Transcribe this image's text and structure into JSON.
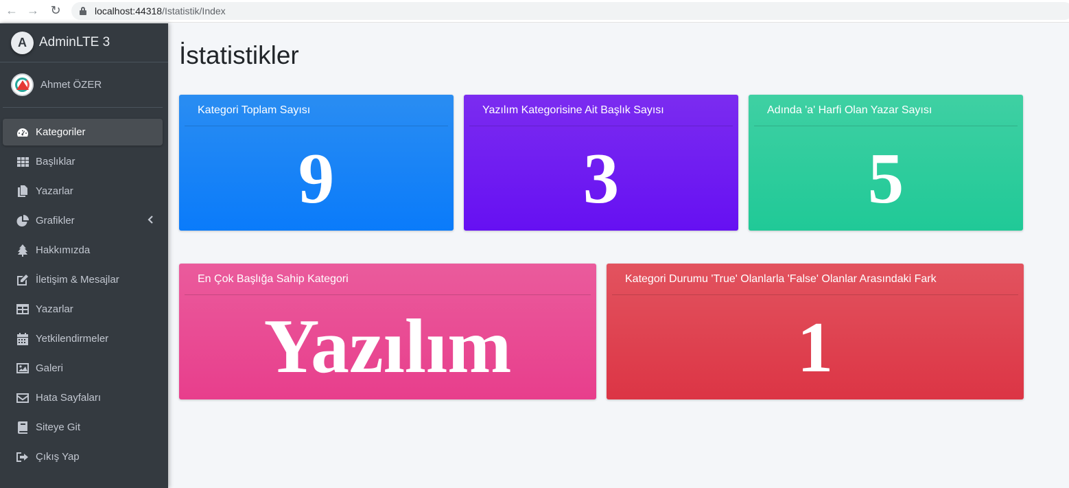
{
  "browser": {
    "url_host": "localhost:44318",
    "url_path": "/Istatistik/Index"
  },
  "sidebar": {
    "brand": "AdminLTE 3",
    "brand_logo_letter": "A",
    "user_name": "Ahmet ÖZER",
    "items": [
      {
        "label": "Kategoriler",
        "icon": "tachometer-icon",
        "active": true
      },
      {
        "label": "Başlıklar",
        "icon": "grid-icon"
      },
      {
        "label": "Yazarlar",
        "icon": "copy-icon"
      },
      {
        "label": "Grafikler",
        "icon": "pie-chart-icon"
      },
      {
        "label": "Hakkımızda",
        "icon": "tree-icon"
      },
      {
        "label": "İletişim & Mesajlar",
        "icon": "edit-icon"
      },
      {
        "label": "Yazarlar",
        "icon": "table-icon"
      },
      {
        "label": "Yetkilendirmeler",
        "icon": "calendar-icon"
      },
      {
        "label": "Galeri",
        "icon": "image-icon"
      },
      {
        "label": "Hata Sayfaları",
        "icon": "envelope-icon"
      },
      {
        "label": "Siteye Git",
        "icon": "book-icon"
      },
      {
        "label": "Çıkış Yap",
        "icon": "sign-out-icon"
      }
    ]
  },
  "main": {
    "title": "İstatistikler",
    "cards": [
      {
        "title": "Kategori Toplam Sayısı",
        "value": "9",
        "color": "#007bff"
      },
      {
        "title": "Yazılım Kategorisine Ait Başlık Sayısı",
        "value": "3",
        "color": "#6610f2"
      },
      {
        "title": "Adında 'a' Harfi Olan Yazar Sayısı",
        "value": "5",
        "color": "#20c997"
      },
      {
        "title": "En Çok Başlığa Sahip Kategori",
        "value": "Yazılım",
        "color": "#e83e8c"
      },
      {
        "title": "Kategori Durumu 'True' Olanlarla 'False' Olanlar Arasındaki Fark",
        "value": "1",
        "color": "#dc3545"
      }
    ]
  }
}
